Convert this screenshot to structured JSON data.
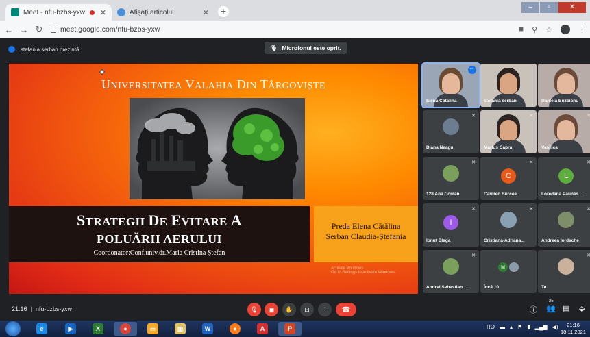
{
  "browser": {
    "tabs": [
      {
        "title": "Meet - nfu-bzbs-yxw",
        "recording": true
      },
      {
        "title": "Afișați articolul"
      }
    ],
    "url": "meet.google.com/nfu-bzbs-yxw",
    "new_tab_label": "+"
  },
  "meet": {
    "presenting_text": "stefania serban prezintă",
    "mic_toast": "Microfonul este oprit.",
    "time": "21:16",
    "meeting_code": "nfu-bzbs-yxw",
    "people_count": "25"
  },
  "slide": {
    "title": "Universitatea Valahia din Târgoviște",
    "title_line1": "Strategii de evitare a",
    "title_line2": "poluării aerului",
    "coordinator": "Coordonator:Conf.univ.dr.Maria Cristina Ștefan",
    "authors": [
      "Preda Elena Cătălina",
      "Șerban Claudia-Ștefania"
    ],
    "watermark": [
      "Activate Windows",
      "Go to Settings to activate Windows."
    ]
  },
  "participants": [
    {
      "name": "Elena Cătălina",
      "kind": "video",
      "active": true,
      "more": true
    },
    {
      "name": "stefania serban",
      "kind": "video"
    },
    {
      "name": "Daniela Buzoianu",
      "kind": "video"
    },
    {
      "name": "Diana Neagu",
      "kind": "image",
      "muted": true
    },
    {
      "name": "Marius Capra",
      "kind": "video",
      "muted": true
    },
    {
      "name": "Vasilica",
      "kind": "video",
      "muted": true
    },
    {
      "name": "128 Ana Coman",
      "kind": "image",
      "muted": true
    },
    {
      "name": "Carmen Burcea",
      "kind": "letter",
      "letter": "C",
      "color": "#e8591a",
      "muted": true
    },
    {
      "name": "Loredana Paunes...",
      "kind": "letter",
      "letter": "L",
      "color": "#5dae3d",
      "muted": true
    },
    {
      "name": "Ionut Blaga",
      "kind": "letter",
      "letter": "I",
      "color": "#9c5ce8",
      "muted": true
    },
    {
      "name": "Cristiana-Adriana...",
      "kind": "image",
      "muted": true
    },
    {
      "name": "Andreea Iordache",
      "kind": "image",
      "muted": true
    },
    {
      "name": "Andrei Sebastian ...",
      "kind": "image",
      "muted": true
    },
    {
      "name": "Încă 10",
      "kind": "chips",
      "chip": "M"
    },
    {
      "name": "Tu",
      "kind": "image",
      "muted": true
    }
  ],
  "taskbar": {
    "language": "RO",
    "time": "21:16",
    "date": "18.11.2021"
  },
  "colors": {
    "accent_blue": "#1a73e8",
    "danger_red": "#ea4335",
    "slide_orange": "#f8a21c"
  }
}
